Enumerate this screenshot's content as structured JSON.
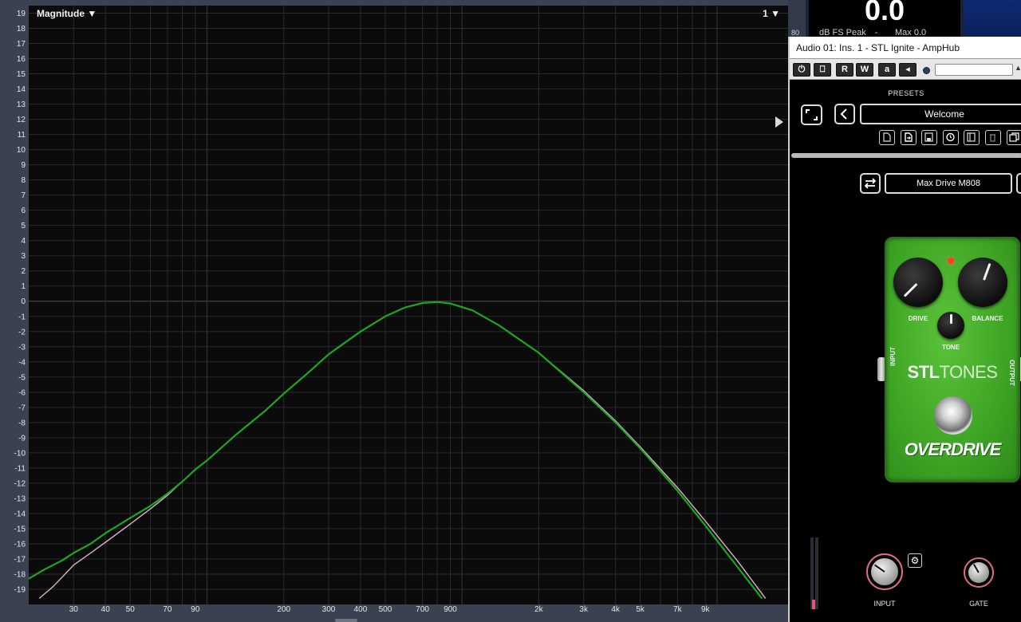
{
  "analyzer": {
    "mode_label": "Magnitude ▼",
    "channel_label": "1 ▼"
  },
  "chart_data": {
    "type": "line",
    "xscale": "log",
    "xlim": [
      20,
      19000
    ],
    "ylim": [
      -20,
      19.5
    ],
    "grid": true,
    "xticks": [
      {
        "value": 30,
        "label": "30"
      },
      {
        "value": 40,
        "label": "40"
      },
      {
        "value": 50,
        "label": "50"
      },
      {
        "value": 70,
        "label": "70"
      },
      {
        "value": 90,
        "label": "90"
      },
      {
        "value": 200,
        "label": "200"
      },
      {
        "value": 300,
        "label": "300"
      },
      {
        "value": 400,
        "label": "400"
      },
      {
        "value": 500,
        "label": "500"
      },
      {
        "value": 700,
        "label": "700"
      },
      {
        "value": 900,
        "label": "900"
      },
      {
        "value": 2000,
        "label": "2k"
      },
      {
        "value": 3000,
        "label": "3k"
      },
      {
        "value": 4000,
        "label": "4k"
      },
      {
        "value": 5000,
        "label": "5k"
      },
      {
        "value": 7000,
        "label": "7k"
      },
      {
        "value": 9000,
        "label": "9k"
      }
    ],
    "yticks": [
      19,
      18,
      17,
      16,
      15,
      14,
      13,
      12,
      11,
      10,
      9,
      8,
      7,
      6,
      5,
      4,
      3,
      2,
      1,
      0,
      -1,
      -2,
      -3,
      -4,
      -5,
      -6,
      -7,
      -8,
      -9,
      -10,
      -11,
      -12,
      -13,
      -14,
      -15,
      -16,
      -17,
      -18,
      -19
    ],
    "series": [
      {
        "color": "#1fa51f",
        "points": [
          [
            20,
            -18.3
          ],
          [
            23,
            -17.7
          ],
          [
            27,
            -17.1
          ],
          [
            30,
            -16.6
          ],
          [
            35,
            -16.0
          ],
          [
            40,
            -15.3
          ],
          [
            50,
            -14.3
          ],
          [
            60,
            -13.5
          ],
          [
            70,
            -12.7
          ],
          [
            80,
            -11.9
          ],
          [
            90,
            -11.1
          ],
          [
            100,
            -10.5
          ],
          [
            130,
            -8.8
          ],
          [
            170,
            -7.2
          ],
          [
            200,
            -6.1
          ],
          [
            250,
            -4.7
          ],
          [
            300,
            -3.5
          ],
          [
            400,
            -2.0
          ],
          [
            500,
            -1.0
          ],
          [
            600,
            -0.4
          ],
          [
            700,
            -0.12
          ],
          [
            800,
            -0.05
          ],
          [
            900,
            -0.15
          ],
          [
            1100,
            -0.6
          ],
          [
            1400,
            -1.6
          ],
          [
            2000,
            -3.4
          ],
          [
            3000,
            -6.0
          ],
          [
            4000,
            -8.0
          ],
          [
            5000,
            -9.7
          ],
          [
            7000,
            -12.5
          ],
          [
            9000,
            -14.8
          ],
          [
            12000,
            -17.5
          ],
          [
            15000,
            -19.6
          ]
        ]
      },
      {
        "color": "#d9b3c9",
        "points": [
          [
            22,
            -19.6
          ],
          [
            25,
            -18.8
          ],
          [
            30,
            -17.4
          ],
          [
            35,
            -16.6
          ],
          [
            40,
            -15.9
          ],
          [
            50,
            -14.7
          ],
          [
            60,
            -13.7
          ],
          [
            70,
            -12.8
          ],
          [
            80,
            -11.9
          ],
          [
            90,
            -11.1
          ],
          [
            100,
            -10.5
          ],
          [
            130,
            -8.8
          ],
          [
            170,
            -7.2
          ],
          [
            200,
            -6.1
          ],
          [
            250,
            -4.7
          ],
          [
            300,
            -3.5
          ],
          [
            400,
            -2.0
          ],
          [
            500,
            -1.0
          ],
          [
            600,
            -0.4
          ],
          [
            700,
            -0.12
          ],
          [
            800,
            -0.05
          ],
          [
            900,
            -0.15
          ],
          [
            1100,
            -0.6
          ],
          [
            1400,
            -1.6
          ],
          [
            2000,
            -3.4
          ],
          [
            3000,
            -5.9
          ],
          [
            4000,
            -7.9
          ],
          [
            5000,
            -9.6
          ],
          [
            7000,
            -12.3
          ],
          [
            9000,
            -14.5
          ],
          [
            12000,
            -17.1
          ],
          [
            15500,
            -19.6
          ]
        ]
      }
    ]
  },
  "meter": {
    "scale_label": "80",
    "value": "0.0",
    "unit": "dB FS Peak",
    "dash": "-",
    "max_label": "Max 0.0"
  },
  "plugin": {
    "title": "Audio 01: Ins. 1 - STL Ignite - AmpHub",
    "toolbar": {
      "power": "⏻",
      "bypass": "⎕",
      "read": "R",
      "write": "W",
      "a_btn": "a",
      "arrow": "◂"
    },
    "presets_label": "PRESETS",
    "preset_name": "Welcome",
    "pedal_selector": "Max Drive M808",
    "pedal": {
      "drive_label": "DRIVE",
      "balance_label": "BALANCE",
      "tone_label": "TONE",
      "brand_bold": "STL",
      "brand_light": "TONES",
      "input_side": "INPUT",
      "output_side": "OUTPUT",
      "name": "OVERDRIVE",
      "drive_angle": -135,
      "balance_angle": 20,
      "tone_angle": 0
    },
    "input_label": "INPUT",
    "gate_label": "GATE",
    "input_angle": -55,
    "gate_angle": -30,
    "gear_icon": "⚙"
  }
}
